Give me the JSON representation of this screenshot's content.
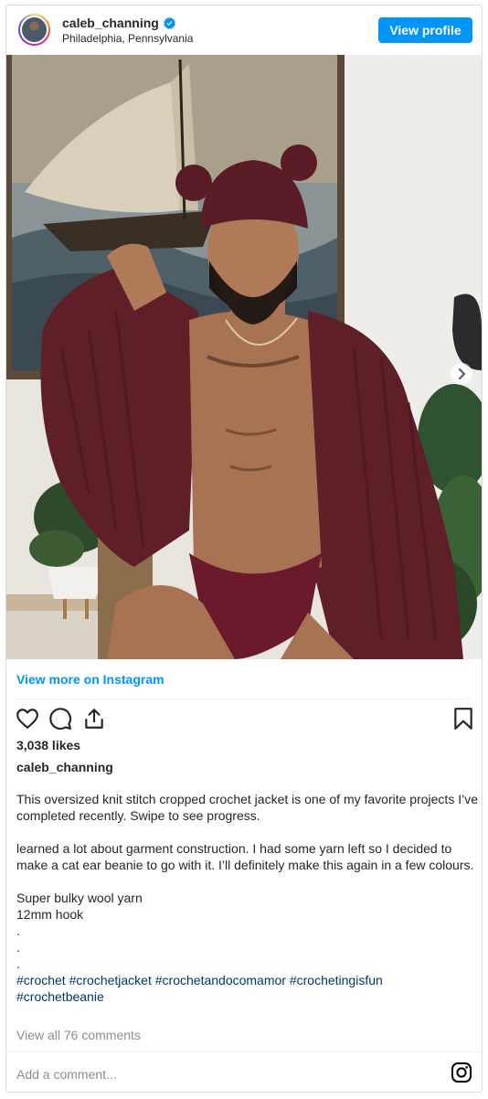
{
  "header": {
    "username": "caleb_channing",
    "location": "Philadelphia, Pennsylvania",
    "view_profile_label": "View profile"
  },
  "post": {
    "view_more_label": "View more on Instagram",
    "likes": "3,038 likes",
    "caption_user": "caleb_channing",
    "caption_lines": [
      "This oversized knit stitch cropped crochet jacket is one of my favorite projects I’ve completed recently. Swipe to see progress.",
      "learned a lot about garment construction. I had some yarn left so I decided to make a cat ear beanie to go with it. I’ll definitely make this again in a few colours.",
      "Super bulky wool yarn",
      "12mm hook",
      ".",
      ".",
      "."
    ],
    "hashtags": [
      "#crochet",
      "#crochetjacket",
      "#crochetandocomamor",
      "#crochetingisfun",
      "#crochetbeanie"
    ],
    "view_comments": "View all 76 comments",
    "add_comment_placeholder": "Add a comment..."
  },
  "icons": {
    "verified": "verified-badge-icon",
    "like": "heart-icon",
    "comment": "comment-icon",
    "share": "share-icon",
    "save": "bookmark-icon",
    "next": "chevron-right-icon",
    "instagram": "instagram-logo-icon"
  },
  "colors": {
    "accent": "#0095f6",
    "hashtag": "#00376b",
    "muted": "#8e8e8e",
    "border": "#dbdbdb"
  }
}
